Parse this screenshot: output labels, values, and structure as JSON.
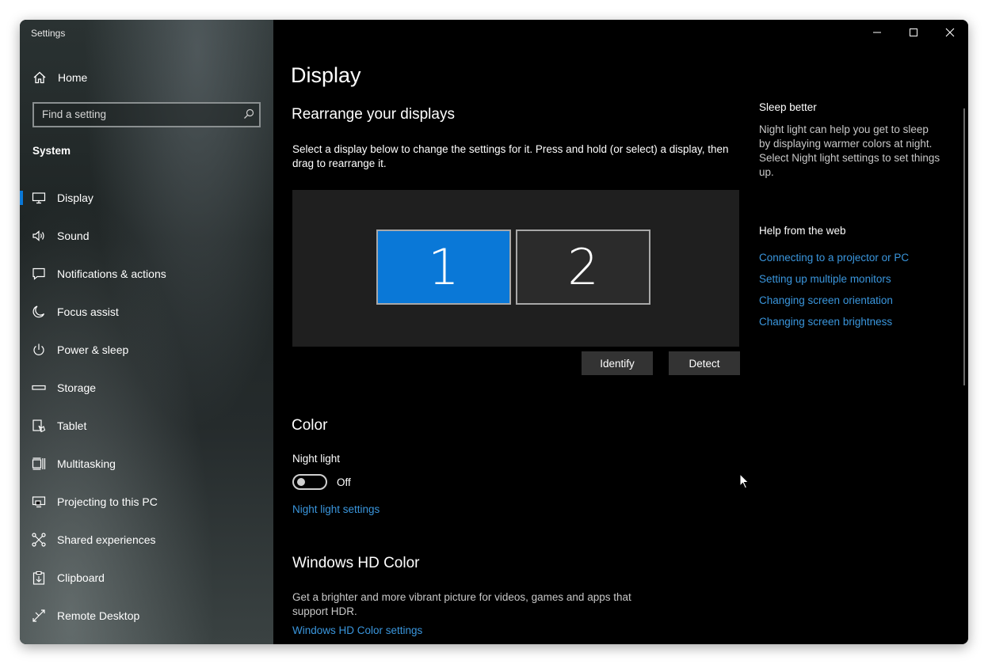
{
  "window": {
    "title": "Settings"
  },
  "sidebar": {
    "home_label": "Home",
    "search_placeholder": "Find a setting",
    "section_title": "System",
    "items": [
      {
        "label": "Display",
        "icon": "monitor-icon",
        "active": true
      },
      {
        "label": "Sound",
        "icon": "speaker-icon"
      },
      {
        "label": "Notifications & actions",
        "icon": "chat-bubble-icon"
      },
      {
        "label": "Focus assist",
        "icon": "moon-icon"
      },
      {
        "label": "Power & sleep",
        "icon": "power-icon"
      },
      {
        "label": "Storage",
        "icon": "storage-icon"
      },
      {
        "label": "Tablet",
        "icon": "tablet-icon"
      },
      {
        "label": "Multitasking",
        "icon": "multitasking-icon"
      },
      {
        "label": "Projecting to this PC",
        "icon": "projector-icon"
      },
      {
        "label": "Shared experiences",
        "icon": "shared-icon"
      },
      {
        "label": "Clipboard",
        "icon": "clipboard-icon"
      },
      {
        "label": "Remote Desktop",
        "icon": "remote-desktop-icon"
      }
    ]
  },
  "main": {
    "page_title": "Display",
    "rearrange": {
      "heading": "Rearrange your displays",
      "description_line1": "Select a display below to change the settings for it. Press and hold (or select) a display, then",
      "description_line2": "drag to rearrange it.",
      "monitor1_label": "1",
      "monitor2_label": "2",
      "identify_label": "Identify",
      "detect_label": "Detect"
    },
    "color": {
      "heading": "Color",
      "night_light_label": "Night light",
      "night_light_state": "Off",
      "night_light_on": false,
      "night_light_settings_link": "Night light settings"
    },
    "hdr": {
      "heading": "Windows HD Color",
      "description_line1": "Get a brighter and more vibrant picture for videos, games and apps that",
      "description_line2": "support HDR.",
      "settings_link": "Windows HD Color settings"
    }
  },
  "aside": {
    "sleep_heading": "Sleep better",
    "sleep_lines": [
      "Night light can help you get to sleep",
      "by displaying warmer colors at night.",
      "Select Night light settings to set things",
      "up."
    ],
    "help_heading": "Help from the web",
    "help_links": [
      "Connecting to a projector or PC",
      "Setting up multiple monitors",
      "Changing screen orientation",
      "Changing screen brightness"
    ]
  },
  "colors": {
    "accent": "#0a78d7",
    "link": "#3a96dd",
    "background": "#000000"
  }
}
